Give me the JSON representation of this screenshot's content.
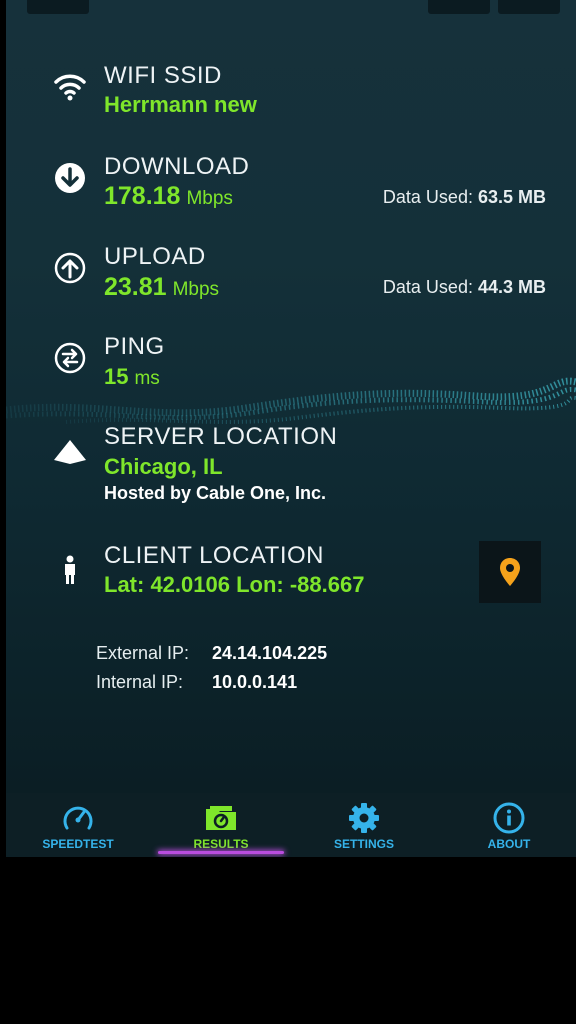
{
  "wifi": {
    "label": "WIFI SSID",
    "value": "Herrmann new"
  },
  "download": {
    "label": "DOWNLOAD",
    "value": "178.18",
    "unit": "Mbps",
    "data_used_label": "Data Used:",
    "data_used_value": "63.5 MB"
  },
  "upload": {
    "label": "UPLOAD",
    "value": "23.81",
    "unit": "Mbps",
    "data_used_label": "Data Used:",
    "data_used_value": "44.3 MB"
  },
  "ping": {
    "label": "PING",
    "value": "15",
    "unit": "ms"
  },
  "server": {
    "label": "SERVER LOCATION",
    "city": "Chicago, IL",
    "hosted": "Hosted by Cable One, Inc."
  },
  "client": {
    "label": "CLIENT LOCATION",
    "coords": "Lat: 42.0106  Lon: -88.667"
  },
  "ip": {
    "external_label": "External IP:",
    "external_value": "24.14.104.225",
    "internal_label": "Internal IP:",
    "internal_value": "10.0.0.141"
  },
  "tabs": [
    {
      "label": "SPEEDTEST",
      "icon": "speedometer-icon"
    },
    {
      "label": "RESULTS",
      "icon": "results-folder-icon",
      "active": true
    },
    {
      "label": "SETTINGS",
      "icon": "gear-icon"
    },
    {
      "label": "ABOUT",
      "icon": "info-icon"
    }
  ],
  "colors": {
    "accent_green": "#7fe62b",
    "tab_blue": "#35b3ea",
    "indicator_purple": "#b94dde",
    "map_pin_orange": "#f5a21b"
  }
}
